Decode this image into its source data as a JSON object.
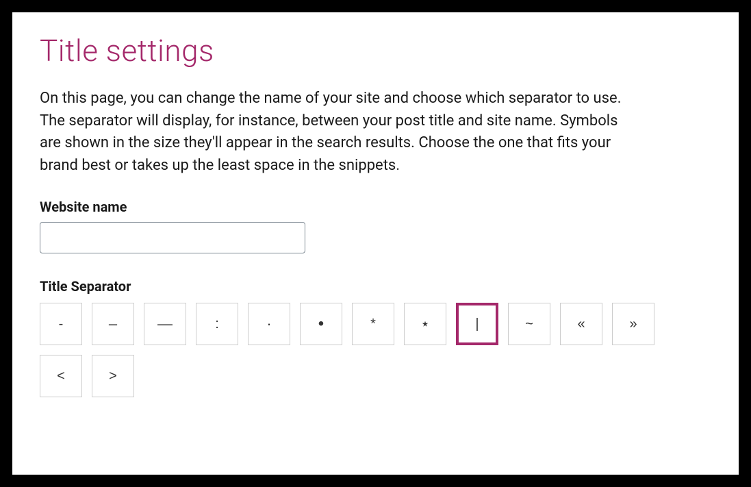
{
  "title": "Title settings",
  "description": "On this page, you can change the name of your site and choose which separator to use. The separator will display, for instance, between your post title and site name. Symbols are shown in the size they'll appear in the search results. Choose the one that fits your brand best or takes up the least space in the snippets.",
  "website_name": {
    "label": "Website name",
    "value": ""
  },
  "separator": {
    "label": "Title Separator",
    "selected_index": 8,
    "options": [
      {
        "symbol": "-",
        "name": "dash"
      },
      {
        "symbol": "–",
        "name": "ndash"
      },
      {
        "symbol": "—",
        "name": "mdash"
      },
      {
        "symbol": ":",
        "name": "colon"
      },
      {
        "symbol": "·",
        "name": "middot"
      },
      {
        "symbol": "•",
        "name": "bull"
      },
      {
        "symbol": "*",
        "name": "asterisk"
      },
      {
        "symbol": "⋆",
        "name": "star"
      },
      {
        "symbol": "|",
        "name": "pipe"
      },
      {
        "symbol": "~",
        "name": "tilde"
      },
      {
        "symbol": "«",
        "name": "laquo"
      },
      {
        "symbol": "»",
        "name": "raquo"
      },
      {
        "symbol": "<",
        "name": "lt"
      },
      {
        "symbol": ">",
        "name": "gt"
      }
    ]
  }
}
